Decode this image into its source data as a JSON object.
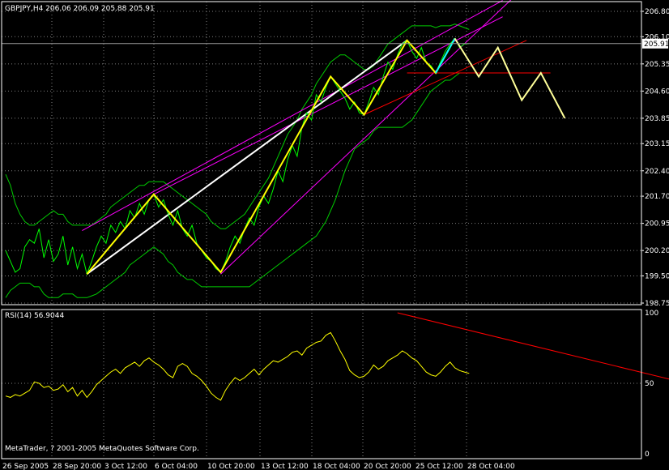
{
  "chart_data": [
    {
      "type": "line",
      "title": "GBPJPY,H4  206.06 206.09 205.88 205.91",
      "ylim": [
        198.75,
        206.8
      ],
      "y_ticks": [
        206.8,
        206.1,
        205.35,
        204.6,
        203.85,
        203.15,
        202.4,
        201.7,
        200.95,
        200.2,
        199.5,
        198.75
      ],
      "y_tick_labels": [
        "206.80",
        "206.10",
        "205.35",
        "204.60",
        "203.85",
        "203.15",
        "202.40",
        "201.70",
        "200.95",
        "200.20",
        "199.50",
        "198.75"
      ],
      "current_price": "205.91",
      "grid": true,
      "x_tick_labels": [
        "26 Sep 2005",
        "28 Sep 20:00",
        "3 Oct 12:00",
        "6 Oct 04:00",
        "10 Oct 20:00",
        "13 Oct 12:00",
        "18 Oct 04:00",
        "20 Oct 20:00",
        "25 Oct 12:00",
        "28 Oct 04:00"
      ],
      "zigzag": [
        [
          17,
          199.55
        ],
        [
          31,
          201.75
        ],
        [
          45,
          199.6
        ],
        [
          68,
          205.0
        ],
        [
          75,
          203.95
        ],
        [
          84,
          206.0
        ],
        [
          90,
          205.1
        ],
        [
          94,
          206.05
        ]
      ],
      "zigzag_recent": [
        [
          90,
          205.1
        ],
        [
          94,
          206.05
        ]
      ],
      "projection": [
        [
          94,
          206.05
        ],
        [
          99,
          205.0
        ],
        [
          103,
          205.8
        ],
        [
          108,
          204.35
        ],
        [
          112,
          205.1
        ],
        [
          117,
          203.85
        ]
      ],
      "white_line": [
        [
          17,
          199.55
        ],
        [
          84,
          206.0
        ]
      ],
      "magenta_lines": [
        [
          [
            16,
            200.75
          ],
          [
            104,
            207.1
          ]
        ],
        [
          [
            45,
            199.55
          ],
          [
            108,
            207.4
          ]
        ],
        [
          [
            31,
            201.75
          ],
          [
            104,
            206.65
          ]
        ]
      ],
      "red_lines": [
        [
          [
            75,
            203.95
          ],
          [
            109,
            206.0
          ]
        ],
        [
          [
            84,
            205.1
          ],
          [
            114,
            205.1
          ]
        ]
      ],
      "price": [
        200.2,
        199.9,
        199.6,
        199.7,
        200.3,
        200.5,
        200.4,
        200.8,
        200.0,
        200.5,
        199.9,
        200.1,
        200.6,
        199.8,
        200.3,
        199.7,
        200.1,
        199.55,
        199.9,
        200.3,
        200.6,
        200.4,
        200.9,
        200.7,
        201.0,
        200.8,
        201.3,
        201.1,
        201.5,
        201.2,
        201.6,
        201.75,
        201.4,
        201.6,
        201.2,
        200.9,
        201.3,
        200.8,
        200.6,
        200.9,
        200.4,
        200.2,
        200.0,
        199.9,
        199.7,
        199.6,
        199.9,
        200.3,
        200.6,
        200.4,
        200.8,
        201.1,
        200.9,
        201.4,
        201.7,
        201.5,
        201.9,
        202.4,
        202.1,
        202.7,
        203.1,
        202.8,
        203.6,
        204.0,
        203.8,
        204.5,
        204.3,
        204.7,
        205.0,
        204.8,
        204.6,
        204.4,
        204.1,
        204.3,
        204.0,
        203.95,
        204.3,
        204.7,
        204.5,
        205.0,
        205.4,
        205.2,
        205.6,
        205.9,
        206.0,
        205.7,
        205.5,
        205.8,
        205.4,
        205.3,
        205.1,
        205.4,
        205.7,
        205.9,
        206.05,
        205.8,
        205.9,
        205.91
      ],
      "bb_upper": [
        202.3,
        202.0,
        201.5,
        201.2,
        201.0,
        200.9,
        200.9,
        201.0,
        201.1,
        201.2,
        201.3,
        201.2,
        201.2,
        201.0,
        200.9,
        200.9,
        200.9,
        200.9,
        200.9,
        201.0,
        201.1,
        201.2,
        201.4,
        201.5,
        201.6,
        201.7,
        201.8,
        201.9,
        202.0,
        202.0,
        202.1,
        202.1,
        202.1,
        202.1,
        202.0,
        201.9,
        201.8,
        201.7,
        201.6,
        201.5,
        201.4,
        201.3,
        201.2,
        201.0,
        200.9,
        200.8,
        200.8,
        200.9,
        201.0,
        201.1,
        201.2,
        201.4,
        201.6,
        201.8,
        202.0,
        202.2,
        202.5,
        202.8,
        203.1,
        203.4,
        203.6,
        203.8,
        204.1,
        204.3,
        204.5,
        204.8,
        205.0,
        205.2,
        205.4,
        205.5,
        205.6,
        205.6,
        205.5,
        205.4,
        205.3,
        205.2,
        205.2,
        205.3,
        205.5,
        205.7,
        205.9,
        206.0,
        206.1,
        206.2,
        206.3,
        206.4,
        206.4,
        206.4,
        206.4,
        206.4,
        206.35,
        206.4,
        206.4,
        206.4,
        206.45,
        206.4,
        206.35,
        206.3
      ],
      "bb_lower": [
        198.9,
        199.1,
        199.2,
        199.3,
        199.3,
        199.3,
        199.2,
        199.2,
        199.0,
        198.9,
        198.9,
        198.9,
        199.0,
        199.0,
        199.0,
        198.9,
        198.9,
        198.9,
        198.95,
        199.0,
        199.1,
        199.2,
        199.3,
        199.4,
        199.5,
        199.6,
        199.8,
        199.9,
        200.0,
        200.1,
        200.2,
        200.3,
        200.2,
        200.1,
        199.9,
        199.8,
        199.6,
        199.5,
        199.4,
        199.4,
        199.3,
        199.2,
        199.2,
        199.2,
        199.2,
        199.2,
        199.2,
        199.2,
        199.2,
        199.2,
        199.2,
        199.2,
        199.3,
        199.4,
        199.5,
        199.6,
        199.7,
        199.8,
        199.9,
        200.0,
        200.1,
        200.2,
        200.3,
        200.4,
        200.5,
        200.6,
        200.8,
        201.0,
        201.3,
        201.6,
        202.0,
        202.4,
        202.7,
        203.0,
        203.1,
        203.2,
        203.3,
        203.5,
        203.6,
        203.6,
        203.6,
        203.6,
        203.6,
        203.6,
        203.7,
        203.8,
        204.0,
        204.2,
        204.4,
        204.6,
        204.7,
        204.8,
        204.9,
        204.9,
        205.0,
        205.1,
        205.1,
        205.1
      ]
    },
    {
      "type": "line",
      "title": "RSI(14) 56.9044",
      "ylim": [
        0,
        100
      ],
      "y_ticks": [
        100,
        50,
        0
      ],
      "y_tick_labels": [
        "100",
        "50",
        "0"
      ],
      "grid": true,
      "values": [
        41,
        40,
        42,
        41,
        43,
        45,
        51,
        50,
        47,
        48,
        45,
        46,
        49,
        44,
        47,
        41,
        45,
        40,
        44,
        49,
        52,
        55,
        58,
        60,
        57,
        61,
        63,
        65,
        62,
        66,
        68,
        65,
        63,
        60,
        56,
        54,
        62,
        64,
        62,
        57,
        55,
        52,
        48,
        43,
        40,
        38,
        45,
        50,
        54,
        52,
        54,
        57,
        60,
        56,
        60,
        63,
        66,
        65,
        67,
        69,
        72,
        73,
        70,
        75,
        77,
        79,
        80,
        84,
        86,
        80,
        73,
        67,
        59,
        56,
        54,
        55,
        58,
        63,
        60,
        62,
        66,
        68,
        70,
        73,
        71,
        68,
        66,
        62,
        58,
        56,
        55,
        58,
        62,
        65,
        61,
        59,
        58,
        57
      ],
      "trendline": [
        [
          82,
          100
        ],
        [
          140,
          52
        ]
      ]
    }
  ],
  "watermark": "MetaTrader, ? 2001-2005 MetaQuotes Software Corp.",
  "colors": {
    "background": "#000000",
    "grid": "#7f7f7f",
    "price_line": "#00ff00",
    "bands": "#00cc00",
    "zigzag": "#ffff00",
    "zigzag_recent": "#00ffff",
    "projection": "#ffff99",
    "white_line": "#ffffff",
    "magenta": "#ff00ff",
    "red": "#ff0000",
    "rsi_line": "#ffff00",
    "axis_text": "#ffffff"
  },
  "icons": {
    "current_price_marker": "price-tag-icon"
  }
}
